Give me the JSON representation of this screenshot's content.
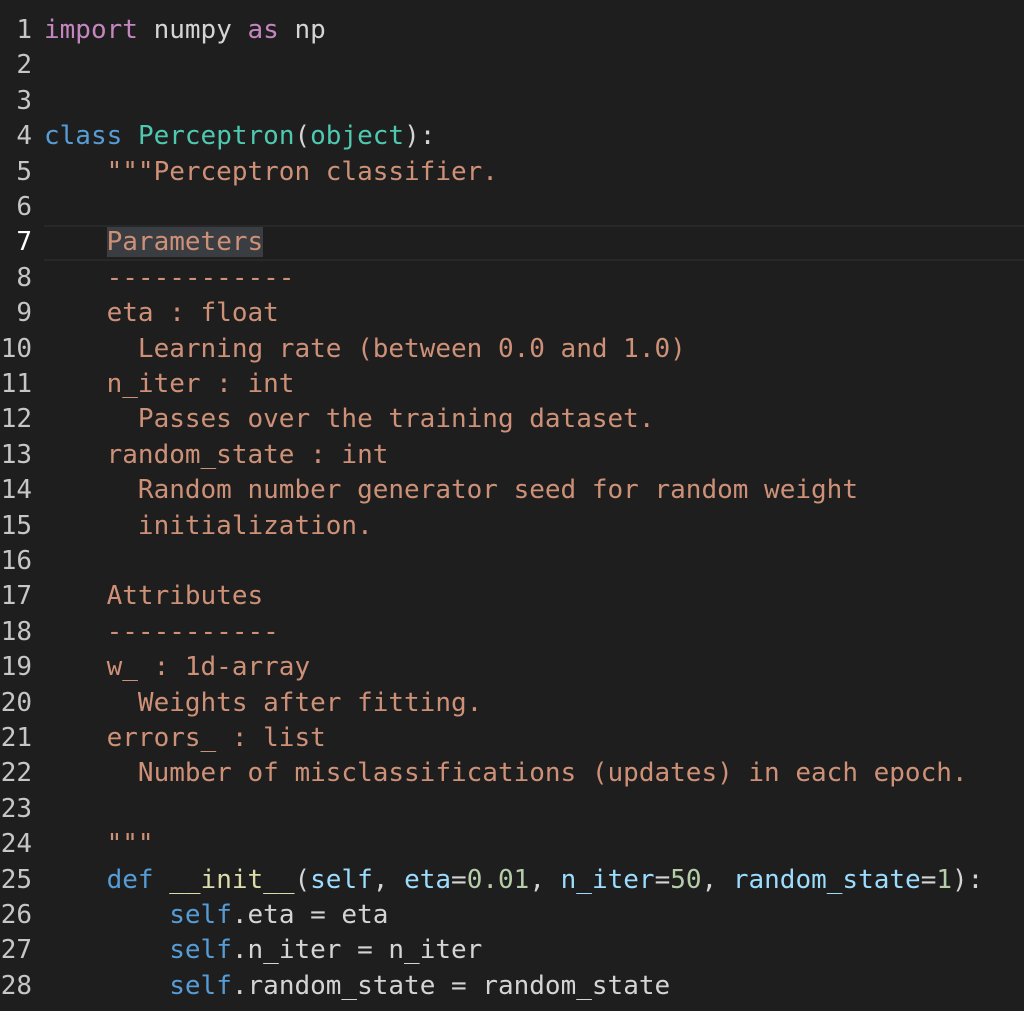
{
  "colors": {
    "background": "#1e1e1e",
    "line_number": "#c6c6c6",
    "keyword_import": "#c586c0",
    "keyword_class_def": "#569cd6",
    "class_name": "#4ec9b0",
    "string": "#ce9178",
    "variable": "#9cdcfe",
    "number": "#b5cea8",
    "function": "#dcdcaa",
    "plain": "#d4d4d4"
  },
  "editor": {
    "current_line": 7,
    "lines": [
      {
        "num": "1",
        "tokens": [
          {
            "t": "import",
            "c": "#c586c0"
          },
          {
            "t": " numpy ",
            "c": "#d4d4d4"
          },
          {
            "t": "as",
            "c": "#c586c0"
          },
          {
            "t": " np",
            "c": "#d4d4d4"
          }
        ]
      },
      {
        "num": "2",
        "tokens": []
      },
      {
        "num": "3",
        "tokens": []
      },
      {
        "num": "4",
        "tokens": [
          {
            "t": "class",
            "c": "#569cd6"
          },
          {
            "t": " ",
            "c": "#d4d4d4"
          },
          {
            "t": "Perceptron",
            "c": "#4ec9b0"
          },
          {
            "t": "(",
            "c": "#d4d4d4"
          },
          {
            "t": "object",
            "c": "#4ec9b0"
          },
          {
            "t": "):",
            "c": "#d4d4d4"
          }
        ]
      },
      {
        "num": "5",
        "tokens": [
          {
            "t": "    \"\"\"Perceptron classifier.",
            "c": "#ce9178"
          }
        ]
      },
      {
        "num": "6",
        "tokens": []
      },
      {
        "num": "7",
        "tokens": [
          {
            "t": "    ",
            "c": "#ce9178"
          },
          {
            "t": "Parameters",
            "c": "#ce9178",
            "hl": true
          }
        ]
      },
      {
        "num": "8",
        "tokens": [
          {
            "t": "    ------------",
            "c": "#ce9178"
          }
        ]
      },
      {
        "num": "9",
        "tokens": [
          {
            "t": "    eta : float",
            "c": "#ce9178"
          }
        ]
      },
      {
        "num": "10",
        "tokens": [
          {
            "t": "      Learning rate (between 0.0 and 1.0)",
            "c": "#ce9178"
          }
        ]
      },
      {
        "num": "11",
        "tokens": [
          {
            "t": "    n_iter : int",
            "c": "#ce9178"
          }
        ]
      },
      {
        "num": "12",
        "tokens": [
          {
            "t": "      Passes over the training dataset.",
            "c": "#ce9178"
          }
        ]
      },
      {
        "num": "13",
        "tokens": [
          {
            "t": "    random_state : int",
            "c": "#ce9178"
          }
        ]
      },
      {
        "num": "14",
        "tokens": [
          {
            "t": "      Random number generator seed for random weight",
            "c": "#ce9178"
          }
        ]
      },
      {
        "num": "15",
        "tokens": [
          {
            "t": "      initialization.",
            "c": "#ce9178"
          }
        ]
      },
      {
        "num": "16",
        "tokens": []
      },
      {
        "num": "17",
        "tokens": [
          {
            "t": "    Attributes",
            "c": "#ce9178"
          }
        ]
      },
      {
        "num": "18",
        "tokens": [
          {
            "t": "    -----------",
            "c": "#ce9178"
          }
        ]
      },
      {
        "num": "19",
        "tokens": [
          {
            "t": "    w_ : 1d-array",
            "c": "#ce9178"
          }
        ]
      },
      {
        "num": "20",
        "tokens": [
          {
            "t": "      Weights after fitting.",
            "c": "#ce9178"
          }
        ]
      },
      {
        "num": "21",
        "tokens": [
          {
            "t": "    errors_ : list",
            "c": "#ce9178"
          }
        ]
      },
      {
        "num": "22",
        "tokens": [
          {
            "t": "      Number of misclassifications (updates) in each epoch.",
            "c": "#ce9178"
          }
        ]
      },
      {
        "num": "23",
        "tokens": []
      },
      {
        "num": "24",
        "tokens": [
          {
            "t": "    \"\"\"",
            "c": "#ce9178"
          }
        ]
      },
      {
        "num": "25",
        "tokens": [
          {
            "t": "    ",
            "c": "#d4d4d4"
          },
          {
            "t": "def",
            "c": "#569cd6"
          },
          {
            "t": " ",
            "c": "#d4d4d4"
          },
          {
            "t": "__init__",
            "c": "#dcdcaa"
          },
          {
            "t": "(",
            "c": "#d4d4d4"
          },
          {
            "t": "self",
            "c": "#9cdcfe"
          },
          {
            "t": ", ",
            "c": "#d4d4d4"
          },
          {
            "t": "eta",
            "c": "#9cdcfe"
          },
          {
            "t": "=",
            "c": "#d4d4d4"
          },
          {
            "t": "0.01",
            "c": "#b5cea8"
          },
          {
            "t": ", ",
            "c": "#d4d4d4"
          },
          {
            "t": "n_iter",
            "c": "#9cdcfe"
          },
          {
            "t": "=",
            "c": "#d4d4d4"
          },
          {
            "t": "50",
            "c": "#b5cea8"
          },
          {
            "t": ", ",
            "c": "#d4d4d4"
          },
          {
            "t": "random_state",
            "c": "#9cdcfe"
          },
          {
            "t": "=",
            "c": "#d4d4d4"
          },
          {
            "t": "1",
            "c": "#b5cea8"
          },
          {
            "t": "):",
            "c": "#d4d4d4"
          }
        ]
      },
      {
        "num": "26",
        "tokens": [
          {
            "t": "        ",
            "c": "#d4d4d4"
          },
          {
            "t": "self",
            "c": "#569cd6"
          },
          {
            "t": ".eta = eta",
            "c": "#d4d4d4"
          }
        ]
      },
      {
        "num": "27",
        "tokens": [
          {
            "t": "        ",
            "c": "#d4d4d4"
          },
          {
            "t": "self",
            "c": "#569cd6"
          },
          {
            "t": ".n_iter = n_iter",
            "c": "#d4d4d4"
          }
        ]
      },
      {
        "num": "28",
        "tokens": [
          {
            "t": "        ",
            "c": "#d4d4d4"
          },
          {
            "t": "self",
            "c": "#569cd6"
          },
          {
            "t": ".random_state = random_state",
            "c": "#d4d4d4"
          }
        ]
      }
    ]
  }
}
